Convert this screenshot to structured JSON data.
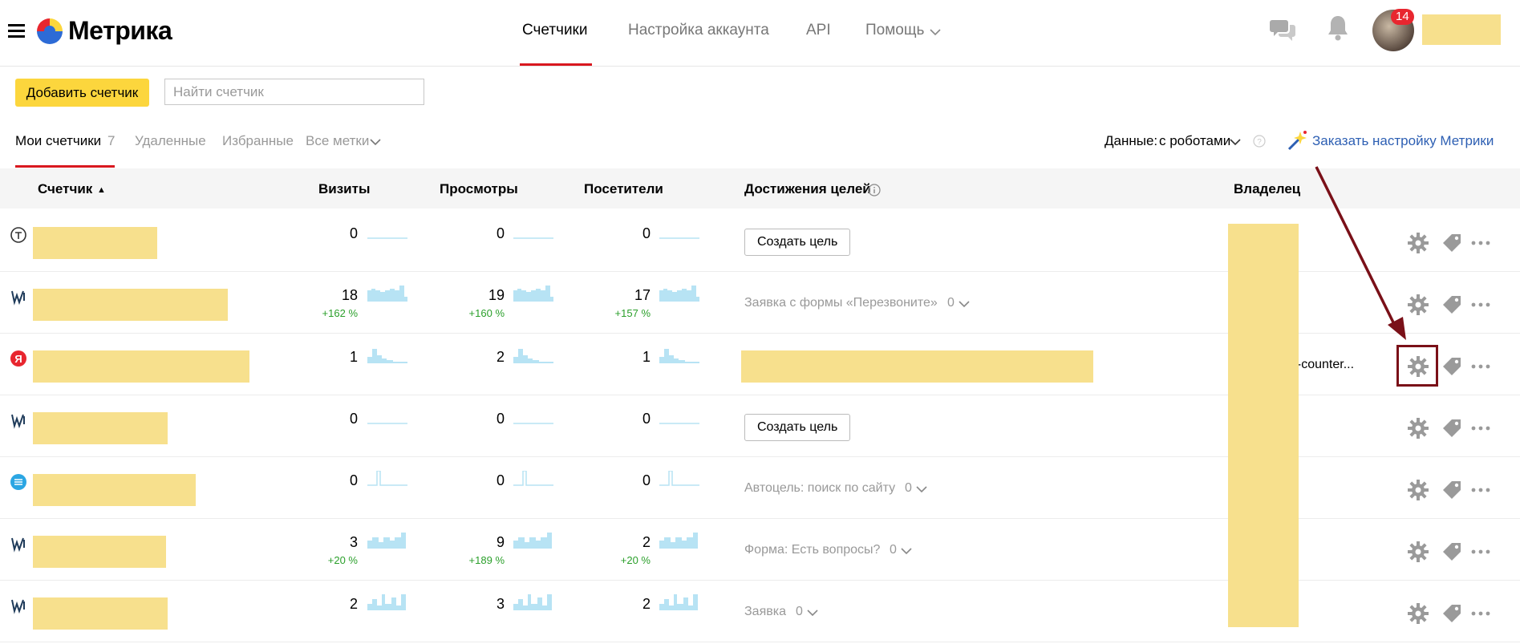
{
  "header": {
    "logo": "Метрика",
    "nav": [
      "Счетчики",
      "Настройка аккаунта",
      "API",
      "Помощь"
    ],
    "notifications_count": "14"
  },
  "toolbar": {
    "add_label": "Добавить счетчик",
    "search_placeholder": "Найти счетчик"
  },
  "tabs": {
    "my": "Мои счетчики",
    "my_count": "7",
    "deleted": "Удаленные",
    "favorites": "Избранные",
    "labels": "Все метки",
    "data_prefix": "Данные:",
    "data_value": "с роботами",
    "order_setup": "Заказать настройку Метрики"
  },
  "columns": {
    "counter": "Счетчик",
    "sort_indicator": "▲",
    "visits": "Визиты",
    "views": "Просмотры",
    "visitors": "Посетители",
    "goals": "Достижения целей",
    "owner": "Владелец"
  },
  "rows": [
    {
      "visits": "0",
      "visits_pct": "",
      "views": "0",
      "views_pct": "",
      "visitors": "0",
      "visitors_pct": "",
      "goal_button": "Создать цель",
      "goal_text": "",
      "goal_count": "",
      "owner": ""
    },
    {
      "visits": "18",
      "visits_pct": "+162 %",
      "views": "19",
      "views_pct": "+160 %",
      "visitors": "17",
      "visitors_pct": "+157 %",
      "goal_button": "",
      "goal_text": "Заявка с формы «Перезвоните»",
      "goal_count": "0",
      "owner": ""
    },
    {
      "visits": "1",
      "visits_pct": "",
      "views": "2",
      "views_pct": "",
      "visitors": "1",
      "visitors_pct": "",
      "goal_button": "",
      "goal_text": "",
      "goal_count": "",
      "owner": "ka-counter..."
    },
    {
      "visits": "0",
      "visits_pct": "",
      "views": "0",
      "views_pct": "",
      "visitors": "0",
      "visitors_pct": "",
      "goal_button": "Создать цель",
      "goal_text": "",
      "goal_count": "",
      "owner": ""
    },
    {
      "visits": "0",
      "visits_pct": "",
      "views": "0",
      "views_pct": "",
      "visitors": "0",
      "visitors_pct": "",
      "goal_button": "",
      "goal_text": "Автоцель: поиск по сайту",
      "goal_count": "0",
      "owner": ""
    },
    {
      "visits": "3",
      "visits_pct": "+20 %",
      "views": "9",
      "views_pct": "+189 %",
      "visitors": "2",
      "visitors_pct": "+20 %",
      "goal_button": "",
      "goal_text": "Форма: Есть вопросы?",
      "goal_count": "0",
      "owner": ""
    },
    {
      "visits": "2",
      "visits_pct": "",
      "views": "3",
      "views_pct": "",
      "visitors": "2",
      "visitors_pct": "",
      "goal_button": "",
      "goal_text": "Заявка",
      "goal_count": "0",
      "owner": ""
    }
  ],
  "colors": {
    "accent": "#d9181f",
    "button": "#fcd63d",
    "highlight": "#f7e08d",
    "sparkline": "#b7e3f4",
    "annotation": "#7a1018"
  },
  "icons": [
    "menu-icon",
    "metrika-logo-icon",
    "chat-icon",
    "bell-icon",
    "avatar",
    "gear-icon",
    "tag-icon",
    "more-icon",
    "wand-icon",
    "info-icon",
    "help-icon"
  ]
}
